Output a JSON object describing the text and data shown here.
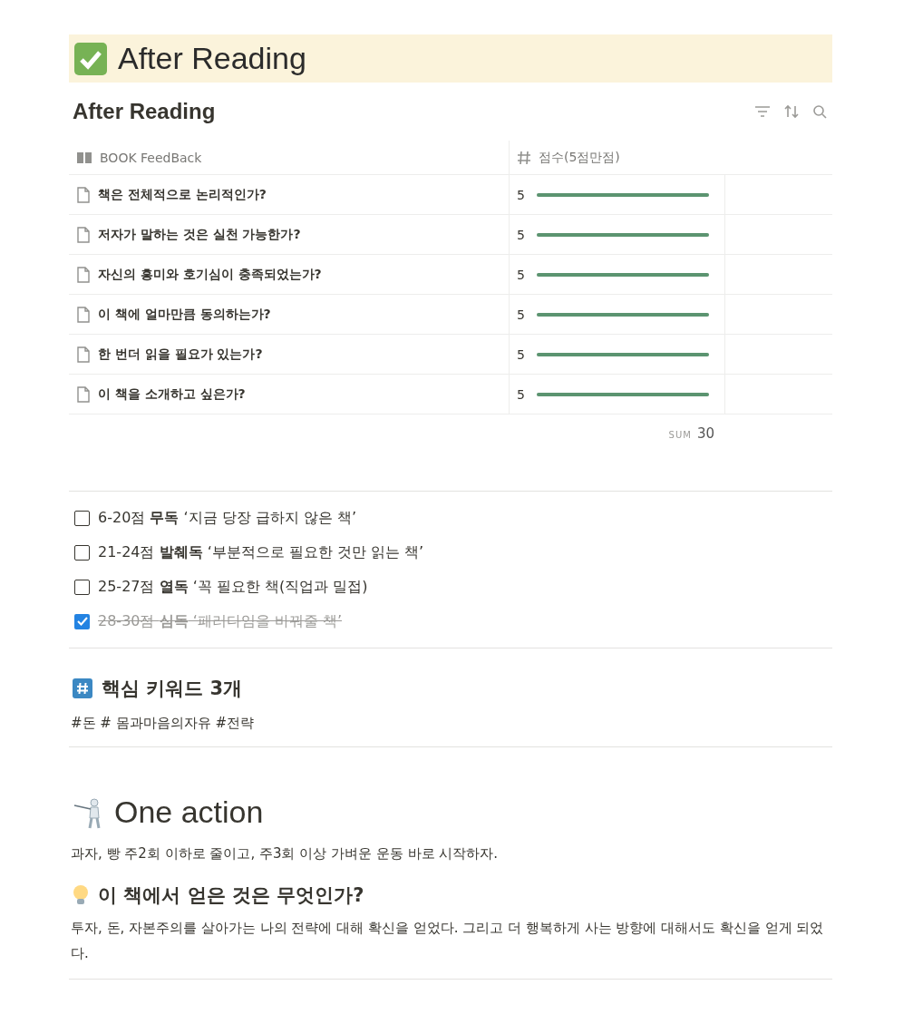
{
  "banner": {
    "title": "After Reading"
  },
  "database": {
    "title": "After Reading",
    "columns": [
      "BOOK FeedBack",
      "점수(5점만점)"
    ],
    "rows": [
      {
        "name": "책은 전체적으로 논리적인가?",
        "score": "5",
        "level": 1
      },
      {
        "name": "저자가 말하는 것은 실천 가능한가?",
        "score": "5",
        "level": 1
      },
      {
        "name": "자신의 흥미와 호기심이 충족되었는가?",
        "score": "5",
        "level": 1
      },
      {
        "name": "이 책에 얼마만큼 동의하는가?",
        "score": "5",
        "level": 1
      },
      {
        "name": "한 번더 읽을 필요가 있는가?",
        "score": "5",
        "level": 1
      },
      {
        "name": "이 책을 소개하고 싶은가?",
        "score": "5",
        "level": 1
      }
    ],
    "sum_label": "SUM",
    "sum_value": "30"
  },
  "todos": [
    {
      "text": "6-20점 **무독** ‘지금 당장 급하지 않은 책’",
      "checked": false
    },
    {
      "text": "21-24점 **발췌독** ‘부분적으로 필요한 것만 읽는 책’",
      "checked": false
    },
    {
      "text": "25-27점 **열독** ‘꼭 필요한 책(직업과 밀접)",
      "checked": false
    },
    {
      "text": "28-30점 **심독** ‘패러다임을 바꿔줄 책’",
      "checked": true
    }
  ],
  "keywords": {
    "heading": "핵심 키워드 3개",
    "text": "#돈 # 몸과마음의자유 #전략"
  },
  "one_action": {
    "heading": "One action",
    "text": "과자, 빵 주2회 이하로 줄이고, 주3회 이상 가벼운 운동 바로 시작하자."
  },
  "gained": {
    "heading": "이 책에서 얻은 것은 무엇인가?",
    "text": "투자, 돈, 자본주의를 살아가는 나의 전략에 대해 확신을 얻었다. 그리고 더 행복하게 사는 방향에 대해서도 확신을 얻게 되었다."
  }
}
